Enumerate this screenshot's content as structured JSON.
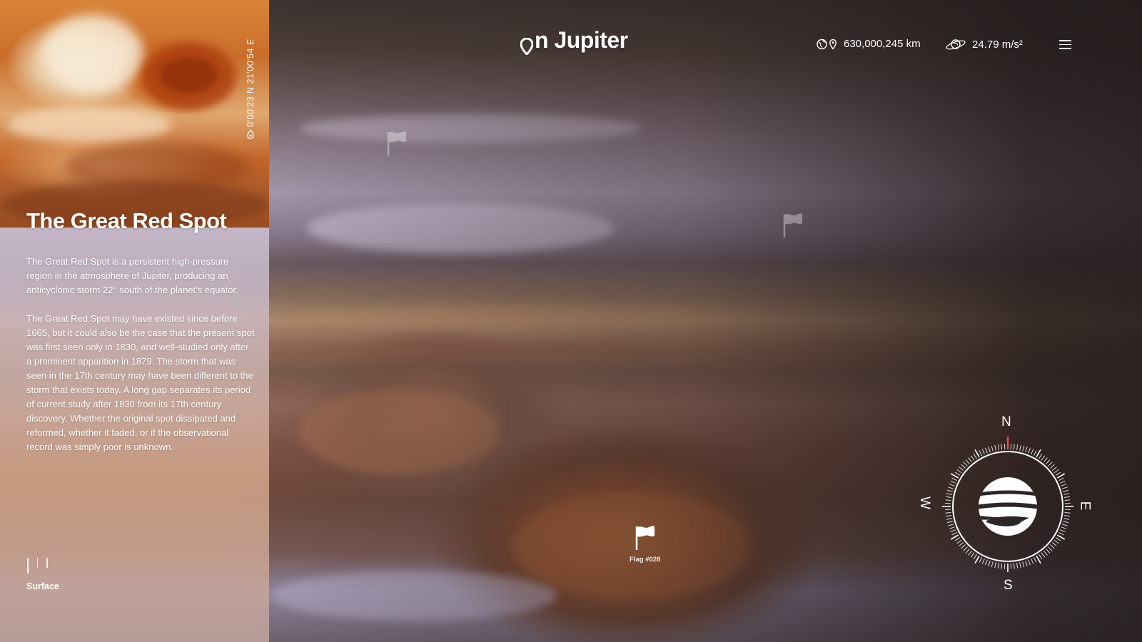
{
  "app": {
    "logo_text": "n Jupiter",
    "logo_prefix_icon": "map-pin-icon"
  },
  "stats": {
    "distance": {
      "icon": "earth-pin-icon",
      "value": "630,000,245 km"
    },
    "gravity": {
      "icon": "planet-orbit-icon",
      "value": "24.79 m/s²"
    }
  },
  "menu": {
    "icon": "hamburger-menu-icon"
  },
  "panel": {
    "coordinates": "0'00'23 N 21'00'54 E",
    "title": "The Great Red Spot",
    "paragraphs": [
      "The Great Red Spot is a persistent high-pressure region in the atmosphere of Jupiter, producing an anticyclonic storm 22° south of the planet's equator.",
      "The Great Red Spot may have existed since before 1665, but it could also be the case that the present spot was first seen only in 1830, and well-studied only after a prominent apparition in 1879. The storm that was seen in the 17th century may have been different to the storm that exists today. A long gap separates its period of current study after 1830 from its 17th century discovery. Whether the original spot dissipated and reformed, whether it faded, or if the observational record was simply poor is unknown."
    ],
    "layer_label": "Surface"
  },
  "flags": [
    {
      "label": "Flag #028",
      "active": true
    }
  ],
  "compass": {
    "north": "N",
    "east": "E",
    "south": "S",
    "west": "W"
  },
  "colors": {
    "compass_needle": "#e0524a",
    "text": "#ffffff"
  }
}
